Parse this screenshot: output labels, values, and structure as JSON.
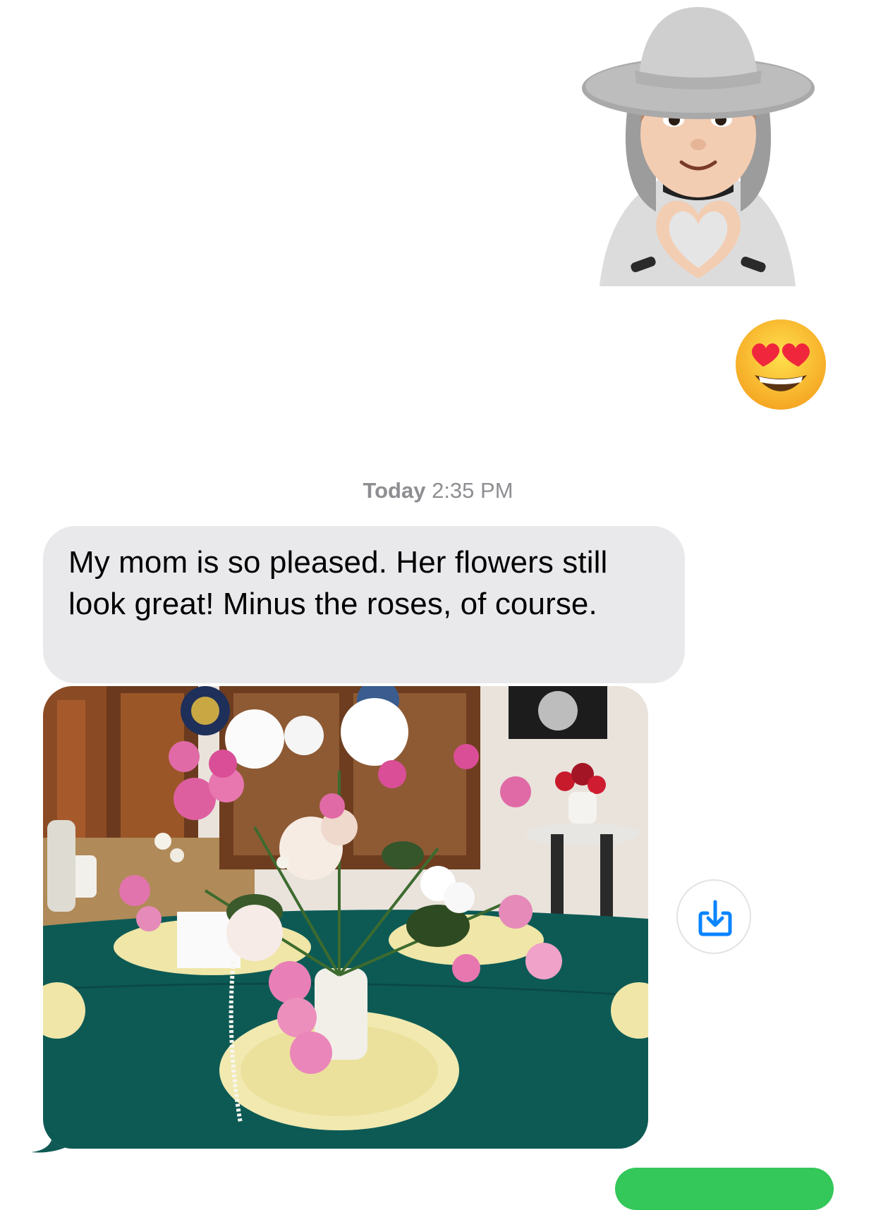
{
  "conversation": {
    "memoji_sticker": {
      "icon": "memoji-heart-hands-sticker"
    },
    "reaction_emoji": {
      "icon": "heart-eyes-emoji"
    },
    "timestamp": {
      "day": "Today",
      "time": "2:35 PM"
    },
    "incoming_message": {
      "text": "My mom is so pleased. Her flowers still look great! Minus the roses, of course.",
      "bubble_color": "#e9e9eb"
    },
    "photo_attachment": {
      "icon": "flower-arrangement-photo"
    },
    "save_button": {
      "icon": "download-save-icon",
      "color": "#0a84ff"
    },
    "outgoing_bubble": {
      "color": "#34c759"
    }
  }
}
